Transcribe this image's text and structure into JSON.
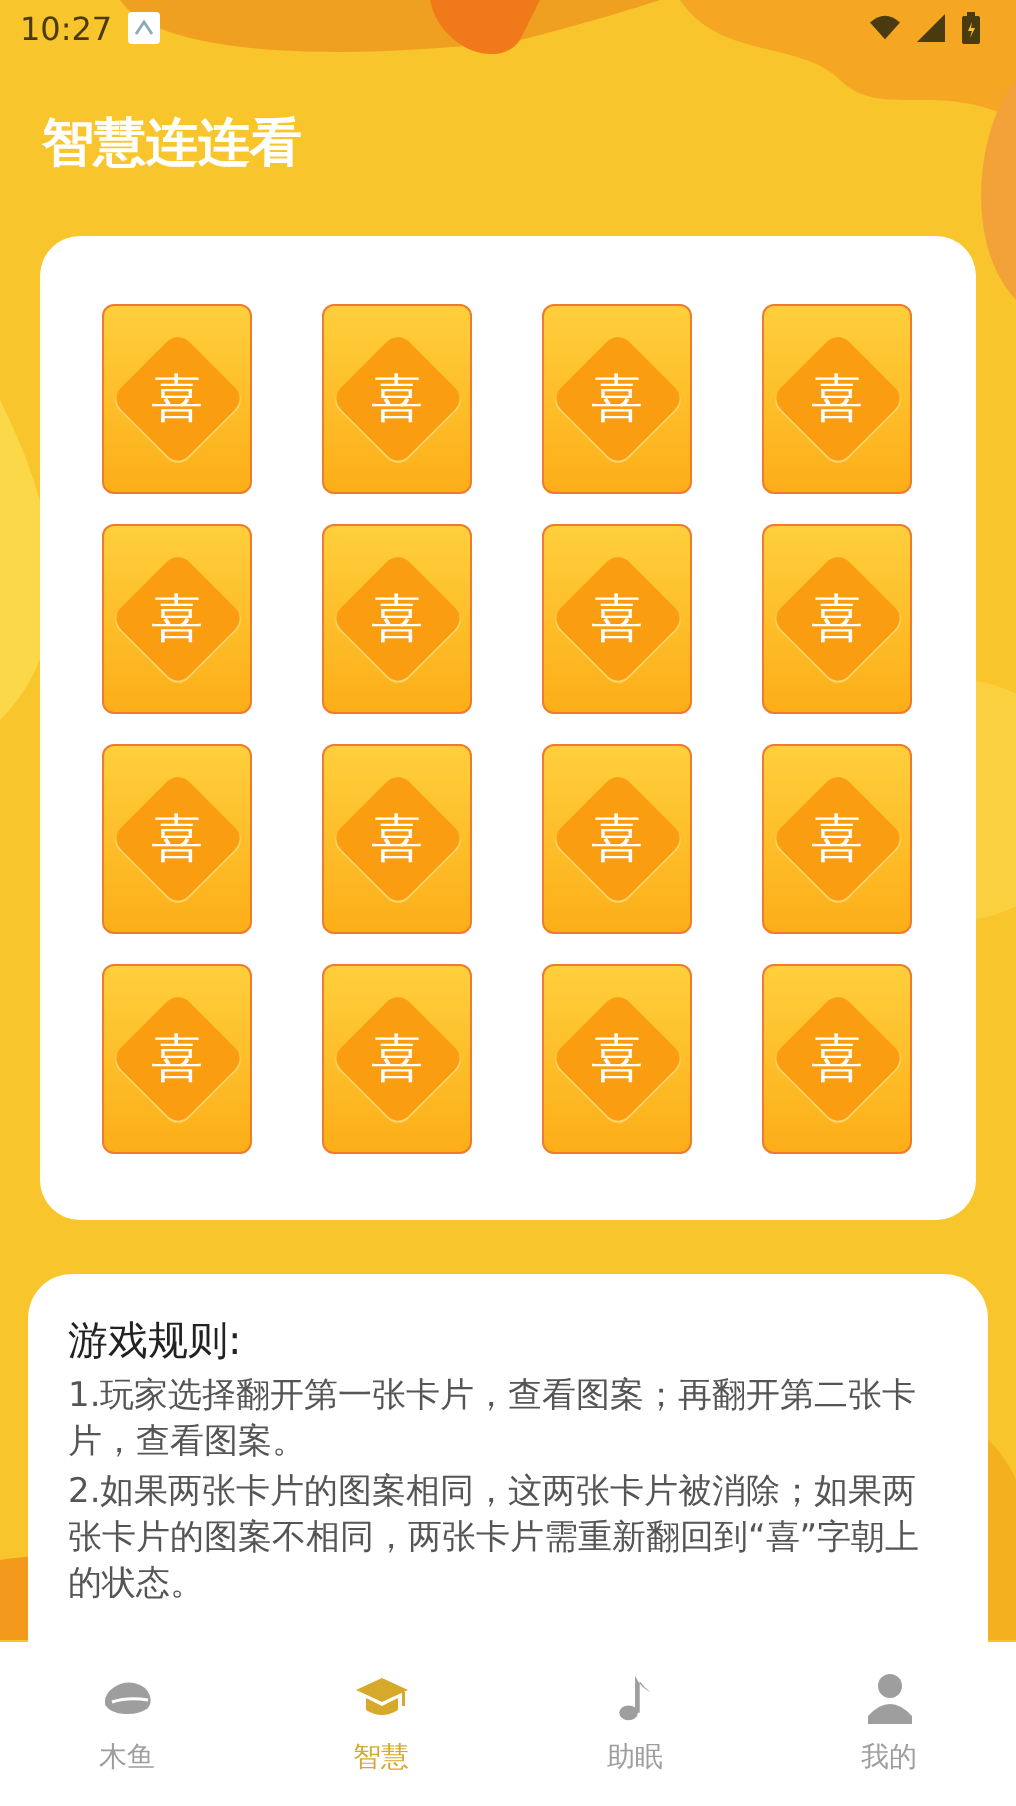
{
  "status_bar": {
    "time": "10:27"
  },
  "title": "智慧连连看",
  "cards": [
    {
      "face": "喜"
    },
    {
      "face": "喜"
    },
    {
      "face": "喜"
    },
    {
      "face": "喜"
    },
    {
      "face": "喜"
    },
    {
      "face": "喜"
    },
    {
      "face": "喜"
    },
    {
      "face": "喜"
    },
    {
      "face": "喜"
    },
    {
      "face": "喜"
    },
    {
      "face": "喜"
    },
    {
      "face": "喜"
    },
    {
      "face": "喜"
    },
    {
      "face": "喜"
    },
    {
      "face": "喜"
    },
    {
      "face": "喜"
    }
  ],
  "rules": {
    "heading": "游戏规则:",
    "lines": [
      "1.玩家选择翻开第一张卡片，查看图案；再翻开第二张卡片，查看图案。",
      "2.如果两张卡片的图案相同，这两张卡片被消除；如果两张卡片的图案不相同，两张卡片需重新翻回到“喜”字朝上的状态。"
    ]
  },
  "tabs": [
    {
      "label": "木鱼",
      "selected": false
    },
    {
      "label": "智慧",
      "selected": true
    },
    {
      "label": "助眠",
      "selected": false
    },
    {
      "label": "我的",
      "selected": false
    }
  ]
}
